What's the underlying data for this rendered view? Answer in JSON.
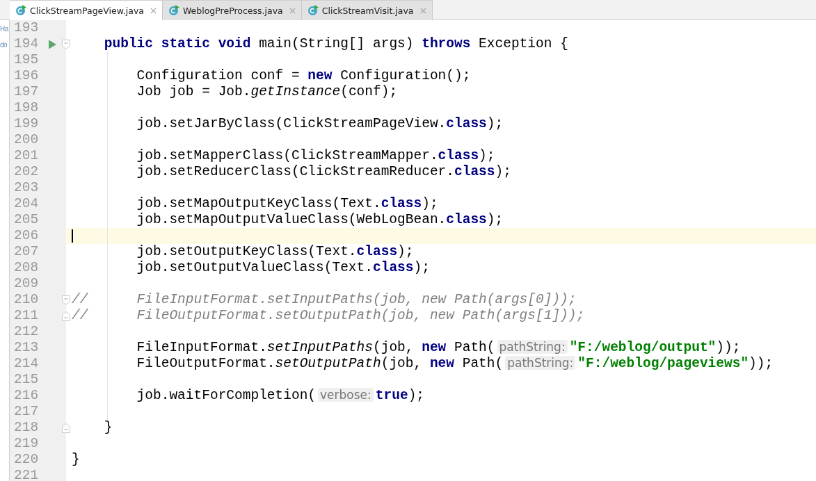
{
  "tabs": [
    {
      "label": "ClickStreamPageView.java",
      "selected": true
    },
    {
      "label": "WeblogPreProcess.java",
      "selected": false
    },
    {
      "label": "ClickStreamVisit.java",
      "selected": false
    }
  ],
  "side_panel": [
    "Ha",
    "do"
  ],
  "lines": [
    {
      "number": "193",
      "kind": "line",
      "current": false,
      "run": false
    },
    {
      "number": "194",
      "kind": "fold_start",
      "current": false,
      "run": true,
      "segments": [
        {
          "kind": "keyword",
          "text": "    public static void"
        },
        {
          "kind": "plain",
          "text": " main(String[] args) "
        },
        {
          "kind": "keyword",
          "text": "throws"
        },
        {
          "kind": "plain",
          "text": " Exception {"
        }
      ]
    },
    {
      "number": "195",
      "kind": "line",
      "current": false,
      "run": false
    },
    {
      "number": "196",
      "kind": "line",
      "current": false,
      "run": false,
      "segments": [
        {
          "kind": "plain",
          "text": "        Configuration conf = "
        },
        {
          "kind": "keyword",
          "text": "new"
        },
        {
          "kind": "plain",
          "text": " Configuration();"
        }
      ]
    },
    {
      "number": "197",
      "kind": "line",
      "current": false,
      "run": false,
      "segments": [
        {
          "kind": "plain",
          "text": "        Job job = Job."
        },
        {
          "kind": "italic",
          "text": "getInstance"
        },
        {
          "kind": "plain",
          "text": "(conf);"
        }
      ]
    },
    {
      "number": "198",
      "kind": "line",
      "current": false,
      "run": false
    },
    {
      "number": "199",
      "kind": "line",
      "current": false,
      "run": false,
      "segments": [
        {
          "kind": "plain",
          "text": "        job.setJarByClass(ClickStreamPageView."
        },
        {
          "kind": "keyword",
          "text": "class"
        },
        {
          "kind": "plain",
          "text": ");"
        }
      ]
    },
    {
      "number": "200",
      "kind": "line",
      "current": false,
      "run": false
    },
    {
      "number": "201",
      "kind": "line",
      "current": false,
      "run": false,
      "segments": [
        {
          "kind": "plain",
          "text": "        job.setMapperClass(ClickStreamMapper."
        },
        {
          "kind": "keyword",
          "text": "class"
        },
        {
          "kind": "plain",
          "text": ");"
        }
      ]
    },
    {
      "number": "202",
      "kind": "line",
      "current": false,
      "run": false,
      "segments": [
        {
          "kind": "plain",
          "text": "        job.setReducerClass(ClickStreamReducer."
        },
        {
          "kind": "keyword",
          "text": "class"
        },
        {
          "kind": "plain",
          "text": ");"
        }
      ]
    },
    {
      "number": "203",
      "kind": "line",
      "current": false,
      "run": false
    },
    {
      "number": "204",
      "kind": "line",
      "current": false,
      "run": false,
      "segments": [
        {
          "kind": "plain",
          "text": "        job.setMapOutputKeyClass(Text."
        },
        {
          "kind": "keyword",
          "text": "class"
        },
        {
          "kind": "plain",
          "text": ");"
        }
      ]
    },
    {
      "number": "205",
      "kind": "line",
      "current": false,
      "run": false,
      "segments": [
        {
          "kind": "plain",
          "text": "        job.setMapOutputValueClass(WebLogBean."
        },
        {
          "kind": "keyword",
          "text": "class"
        },
        {
          "kind": "plain",
          "text": ");"
        }
      ]
    },
    {
      "number": "206",
      "kind": "line",
      "current": true,
      "run": false
    },
    {
      "number": "207",
      "kind": "line",
      "current": false,
      "run": false,
      "segments": [
        {
          "kind": "plain",
          "text": "        job.setOutputKeyClass(Text."
        },
        {
          "kind": "keyword",
          "text": "class"
        },
        {
          "kind": "plain",
          "text": ");"
        }
      ]
    },
    {
      "number": "208",
      "kind": "line",
      "current": false,
      "run": false,
      "segments": [
        {
          "kind": "plain",
          "text": "        job.setOutputValueClass(Text."
        },
        {
          "kind": "keyword",
          "text": "class"
        },
        {
          "kind": "plain",
          "text": ");"
        }
      ]
    },
    {
      "number": "209",
      "kind": "line",
      "current": false,
      "run": false
    },
    {
      "number": "210",
      "kind": "fold_start",
      "current": false,
      "run": false,
      "segments": [
        {
          "kind": "comment",
          "text": "//      FileInputFormat.setInputPaths(job, new Path(args[0]));"
        }
      ]
    },
    {
      "number": "211",
      "kind": "fold_end",
      "current": false,
      "run": false,
      "segments": [
        {
          "kind": "comment",
          "text": "//      FileOutputFormat.setOutputPath(job, new Path(args[1]));"
        }
      ]
    },
    {
      "number": "212",
      "kind": "line",
      "current": false,
      "run": false
    },
    {
      "number": "213",
      "kind": "line",
      "current": false,
      "run": false,
      "segments": [
        {
          "kind": "plain",
          "text": "        FileInputFormat."
        },
        {
          "kind": "italic",
          "text": "setInputPaths"
        },
        {
          "kind": "plain",
          "text": "(job, "
        },
        {
          "kind": "keyword",
          "text": "new"
        },
        {
          "kind": "plain",
          "text": " Path("
        },
        {
          "kind": "hint",
          "text": "pathString:"
        },
        {
          "kind": "string",
          "text": "\"F:/weblog/output\""
        },
        {
          "kind": "plain",
          "text": "));"
        }
      ]
    },
    {
      "number": "214",
      "kind": "line",
      "current": false,
      "run": false,
      "segments": [
        {
          "kind": "plain",
          "text": "        FileOutputFormat."
        },
        {
          "kind": "italic",
          "text": "setOutputPath"
        },
        {
          "kind": "plain",
          "text": "(job, "
        },
        {
          "kind": "keyword",
          "text": "new"
        },
        {
          "kind": "plain",
          "text": " Path("
        },
        {
          "kind": "hint",
          "text": "pathString:"
        },
        {
          "kind": "string",
          "text": "\"F:/weblog/pageviews\""
        },
        {
          "kind": "plain",
          "text": "));"
        }
      ]
    },
    {
      "number": "215",
      "kind": "line",
      "current": false,
      "run": false
    },
    {
      "number": "216",
      "kind": "line",
      "current": false,
      "run": false,
      "segments": [
        {
          "kind": "plain",
          "text": "        job.waitForCompletion("
        },
        {
          "kind": "hint",
          "text": "verbose:"
        },
        {
          "kind": "keyword",
          "text": "true"
        },
        {
          "kind": "plain",
          "text": ");"
        }
      ]
    },
    {
      "number": "217",
      "kind": "line",
      "current": false,
      "run": false
    },
    {
      "number": "218",
      "kind": "fold_end",
      "current": false,
      "run": false,
      "segments": [
        {
          "kind": "plain",
          "text": "    }"
        }
      ]
    },
    {
      "number": "219",
      "kind": "line",
      "current": false,
      "run": false
    },
    {
      "number": "220",
      "kind": "line",
      "current": false,
      "run": false,
      "segments": [
        {
          "kind": "plain",
          "text": "}"
        }
      ]
    },
    {
      "number": "221",
      "kind": "line",
      "current": false,
      "run": false
    }
  ]
}
